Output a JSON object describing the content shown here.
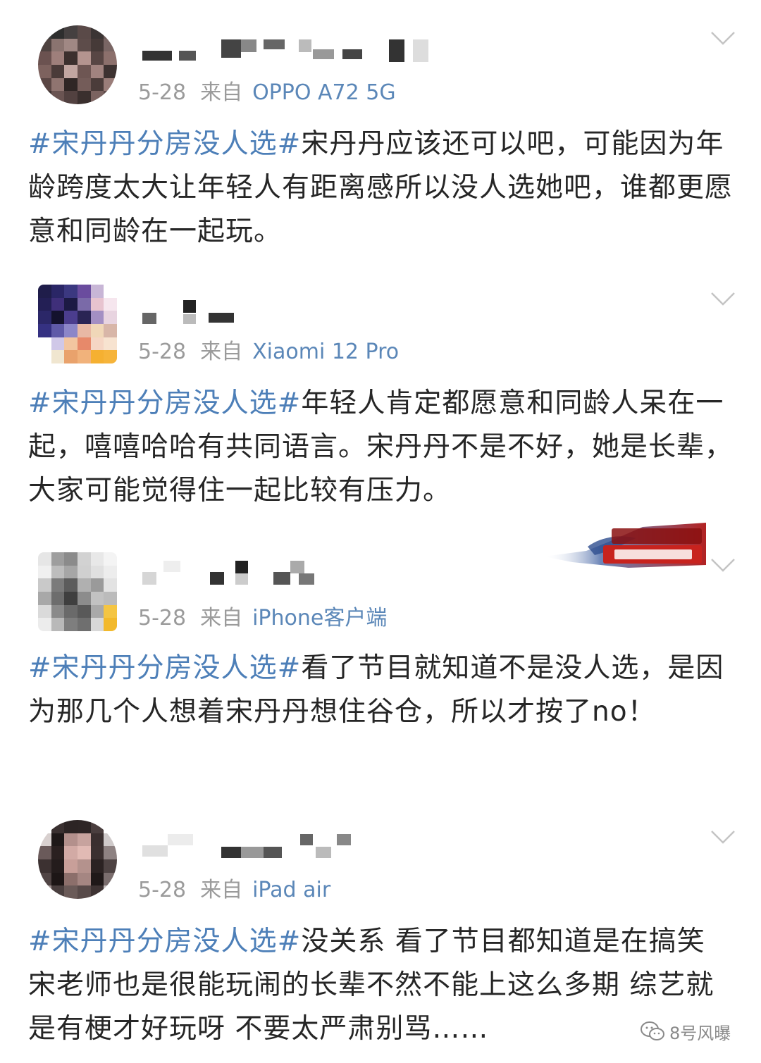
{
  "posts": [
    {
      "date": "5-28",
      "from_label": "来自",
      "device": "OPPO A72 5G",
      "topic": "#宋丹丹分房没人选#",
      "text": "宋丹丹应该还可以吧，可能因为年龄跨度太大让年轻人有距离感所以没人选她吧，谁都更愿意和同龄在一起玩。"
    },
    {
      "date": "5-28",
      "from_label": "来自",
      "device": "Xiaomi 12 Pro",
      "topic": "#宋丹丹分房没人选#",
      "text": "年轻人肯定都愿意和同龄人呆在一起，嘻嘻哈哈有共同语言。宋丹丹不是不好，她是长辈，大家可能觉得住一起比较有压力。"
    },
    {
      "date": "5-28",
      "from_label": "来自",
      "device": "iPhone客户端",
      "topic": "#宋丹丹分房没人选#",
      "text": "看了节目就知道不是没人选，是因为那几个人想着宋丹丹想住谷仓，所以才按了no！"
    },
    {
      "date": "5-28",
      "from_label": "来自",
      "device": "iPad air",
      "topic": "#宋丹丹分房没人选#",
      "text": "没关系 看了节目都知道是在搞笑 宋老师也是很能玩闹的长辈不然不能上这么多期 综艺就是有梗才好玩呀 不要太严肃别骂……"
    }
  ],
  "watermark": {
    "text": "8号风曝",
    "icon": "wechat-icon"
  },
  "colors": {
    "topic": "#4d7fb8",
    "device": "#5b87b8",
    "meta": "#9b9b9b",
    "text": "#262626"
  }
}
